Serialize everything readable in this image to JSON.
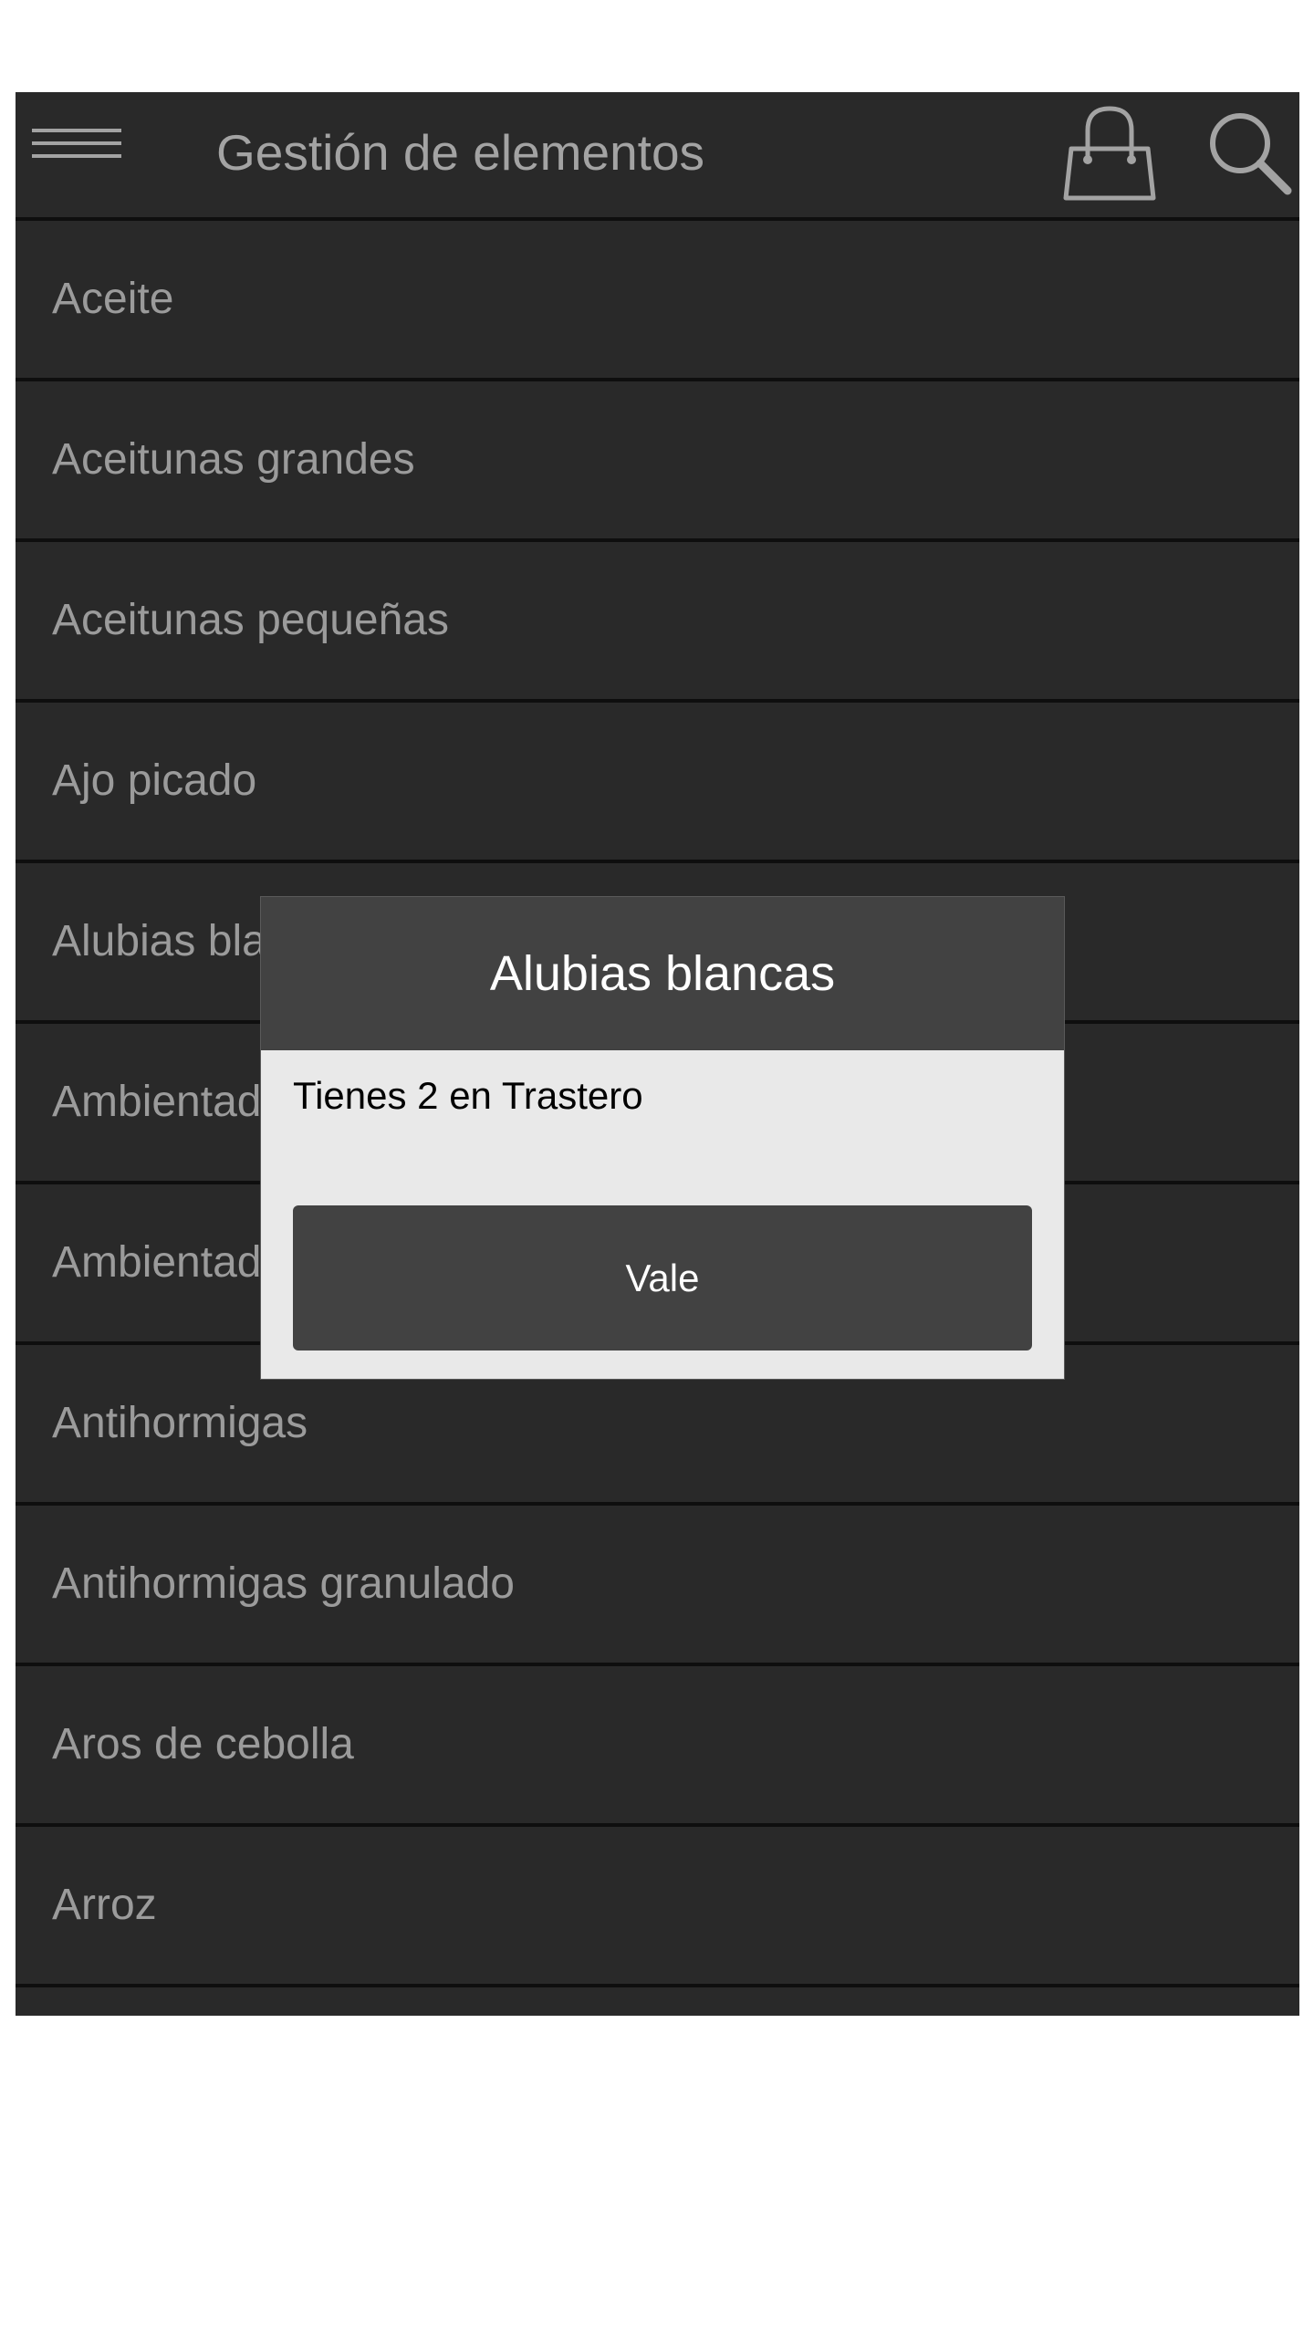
{
  "header": {
    "title": "Gestión de elementos",
    "menu_icon": "hamburger-menu-icon",
    "bag_icon": "shopping-bag-icon",
    "search_icon": "search-icon"
  },
  "list": {
    "items": [
      {
        "label": "Aceite"
      },
      {
        "label": "Aceitunas grandes"
      },
      {
        "label": "Aceitunas pequeñas"
      },
      {
        "label": "Ajo picado"
      },
      {
        "label": "Alubias blancas"
      },
      {
        "label": "Ambientador"
      },
      {
        "label": "Ambientador"
      },
      {
        "label": "Antihormigas"
      },
      {
        "label": "Antihormigas granulado"
      },
      {
        "label": "Aros de cebolla"
      },
      {
        "label": "Arroz"
      },
      {
        "label": ""
      }
    ]
  },
  "dialog": {
    "title": "Alubias blancas",
    "message": "Tienes 2 en Trastero",
    "ok_label": "Vale"
  },
  "colors": {
    "background": "#292929",
    "divider": "#0e0e0e",
    "text": "#9b9b9b",
    "dialog_header": "#424242",
    "dialog_body": "#e9e9e9"
  }
}
